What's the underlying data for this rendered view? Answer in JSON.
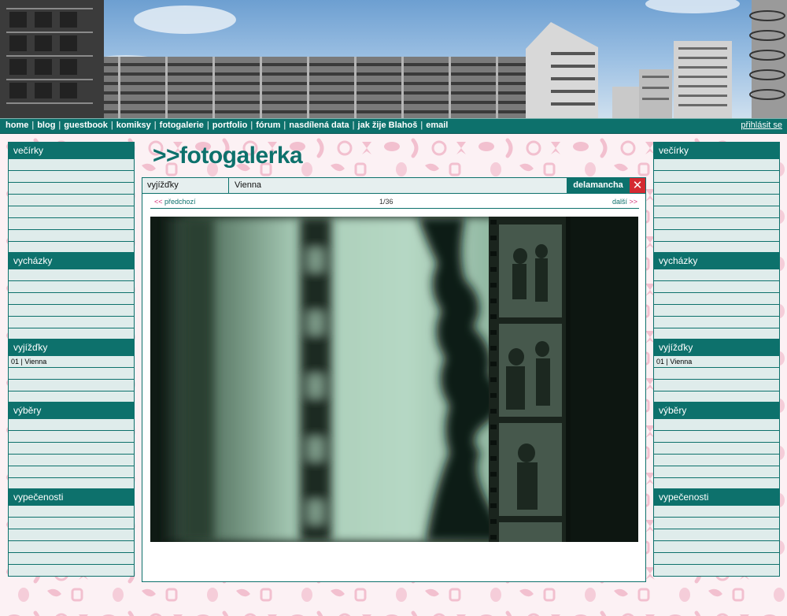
{
  "nav": {
    "items": [
      "home",
      "blog",
      "guestbook",
      "komiksy",
      "fotogalerie",
      "portfolio",
      "fórum",
      "nasdílená data",
      "jak žije Blahoš",
      "email"
    ],
    "login": "přihlásit se"
  },
  "logo": {
    "text": ">>fotogalerka"
  },
  "sidebar": {
    "sections": [
      {
        "title": "večírky",
        "items": []
      },
      {
        "title": "vycházky",
        "items": []
      },
      {
        "title": "vyjížďky",
        "items": [
          "01 | Vienna"
        ]
      },
      {
        "title": "výběry",
        "items": []
      },
      {
        "title": "vypečenosti",
        "items": []
      }
    ]
  },
  "gallery": {
    "category": "vyjížďky",
    "album": "Vienna",
    "author": "delamancha",
    "close_icon": "close-icon",
    "prev_arrows": "<<",
    "prev_label": "předchozí",
    "counter": "1/36",
    "next_label": "další",
    "next_arrows": ">>"
  },
  "colors": {
    "teal": "#0d716c",
    "red": "#d42a31",
    "pink": "#d4357a"
  }
}
